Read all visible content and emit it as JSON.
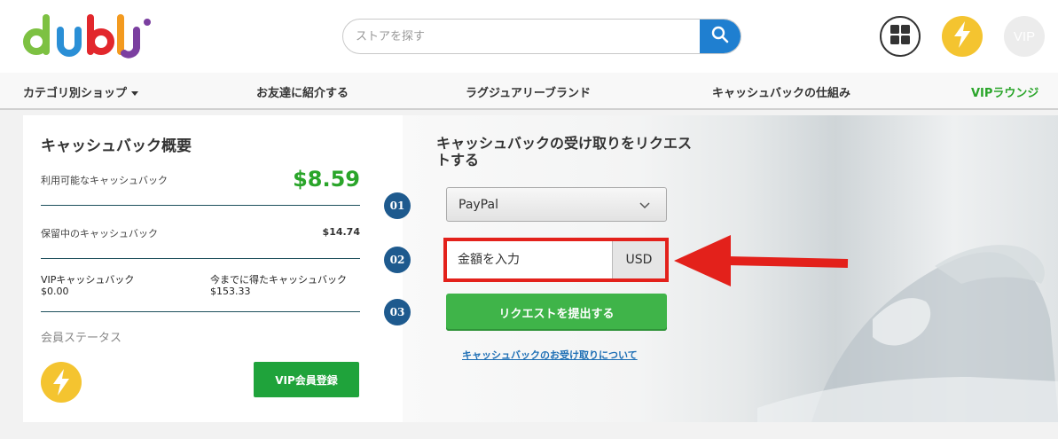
{
  "header": {
    "logo_alt": "dubli",
    "search_placeholder": "ストアを探す",
    "icons": [
      "search-icon",
      "grid-icon",
      "lightning-icon",
      "vip-icon"
    ],
    "vip_label": "VIP"
  },
  "nav": {
    "items": [
      {
        "label": "カテゴリ別ショップ",
        "has_dropdown": true
      },
      {
        "label": "お友達に紹介する"
      },
      {
        "label": "ラグジュアリーブランド"
      },
      {
        "label": "キャッシュバックの仕組み"
      },
      {
        "label": "VIPラウンジ"
      }
    ]
  },
  "summary": {
    "title": "キャッシュバック概要",
    "available_label": "利用可能なキャッシュバック",
    "available_value": "$8.59",
    "pending_label": "保留中のキャッシュバック",
    "pending_value": "$14.74",
    "vip_label": "VIPキャッシュバック",
    "vip_value": "$0.00",
    "earned_label": "今までに得たキャッシュバック",
    "earned_value": "$153.33",
    "status_label": "会員ステータス",
    "vip_register_label": "VIP会員登録"
  },
  "request": {
    "title": "キャッシュバックの受け取りをリクエストする",
    "steps": [
      "01",
      "02",
      "03"
    ],
    "method_value": "PayPal",
    "amount_placeholder": "金額を入力",
    "currency": "USD",
    "submit_label": "リクエストを提出する",
    "info_link": "キャッシュバックのお受け取りについて"
  },
  "colors": {
    "accent_blue": "#1f7fd0",
    "green": "#2aa52a",
    "button_green": "#3fb449",
    "highlight_red": "#e3211b",
    "step_blue": "#1e5a8e",
    "bolt_yellow": "#f4c430"
  }
}
